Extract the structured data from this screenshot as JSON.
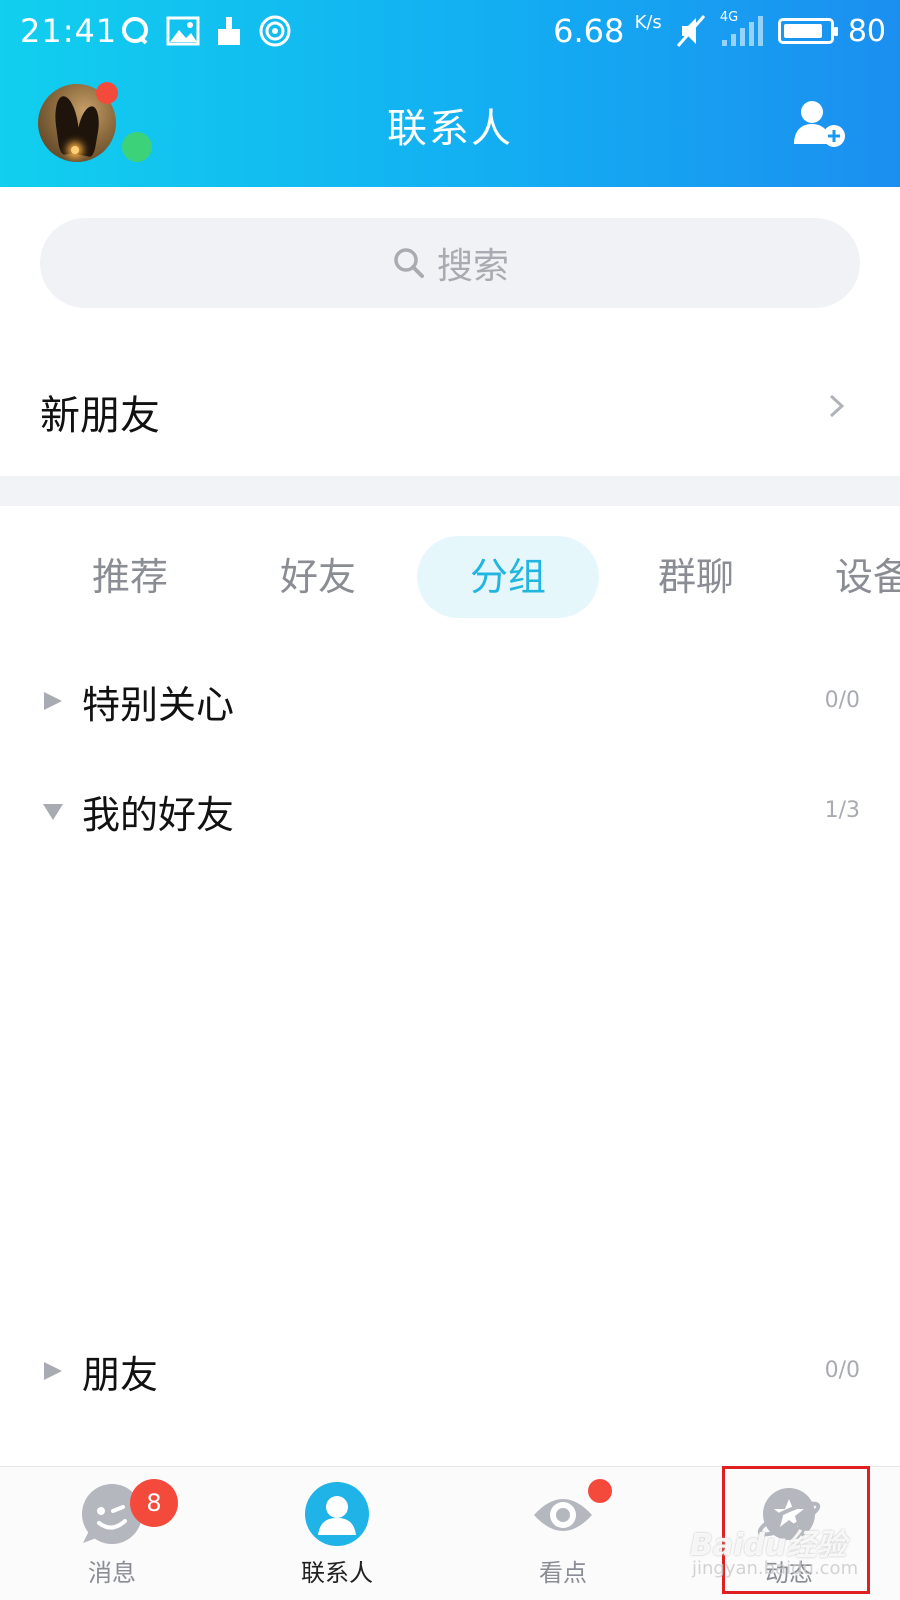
{
  "status_bar": {
    "time": "21:41",
    "speed": "6.68",
    "speed_unit": "K/s",
    "network": "4G",
    "battery": "80"
  },
  "header": {
    "title": "联系人",
    "add_icon": "add-contact-icon"
  },
  "search": {
    "placeholder": "搜索"
  },
  "new_friends": {
    "label": "新朋友"
  },
  "tabs": [
    {
      "label": "推荐",
      "active": false
    },
    {
      "label": "好友",
      "active": false
    },
    {
      "label": "分组",
      "active": true
    },
    {
      "label": "群聊",
      "active": false
    },
    {
      "label": "设备",
      "active": false
    }
  ],
  "groups": [
    {
      "name": "特别关心",
      "count": "0/0",
      "expanded": false
    },
    {
      "name": "我的好友",
      "count": "1/3",
      "expanded": true
    },
    {
      "name": "朋友",
      "count": "0/0",
      "expanded": false
    }
  ],
  "bottom_nav": [
    {
      "label": "消息",
      "badge": "8",
      "active": false
    },
    {
      "label": "联系人",
      "badge": "",
      "active": true
    },
    {
      "label": "看点",
      "badge": "",
      "active": false
    },
    {
      "label": "动态",
      "badge": "",
      "active": false
    }
  ],
  "watermark": {
    "brand": "Baidu经验",
    "url": "jingyan.baidu.com"
  },
  "colors": {
    "header_start": "#11cfee",
    "header_end": "#1b8ff0",
    "accent": "#22b5e0",
    "badge": "#f44a3b"
  }
}
